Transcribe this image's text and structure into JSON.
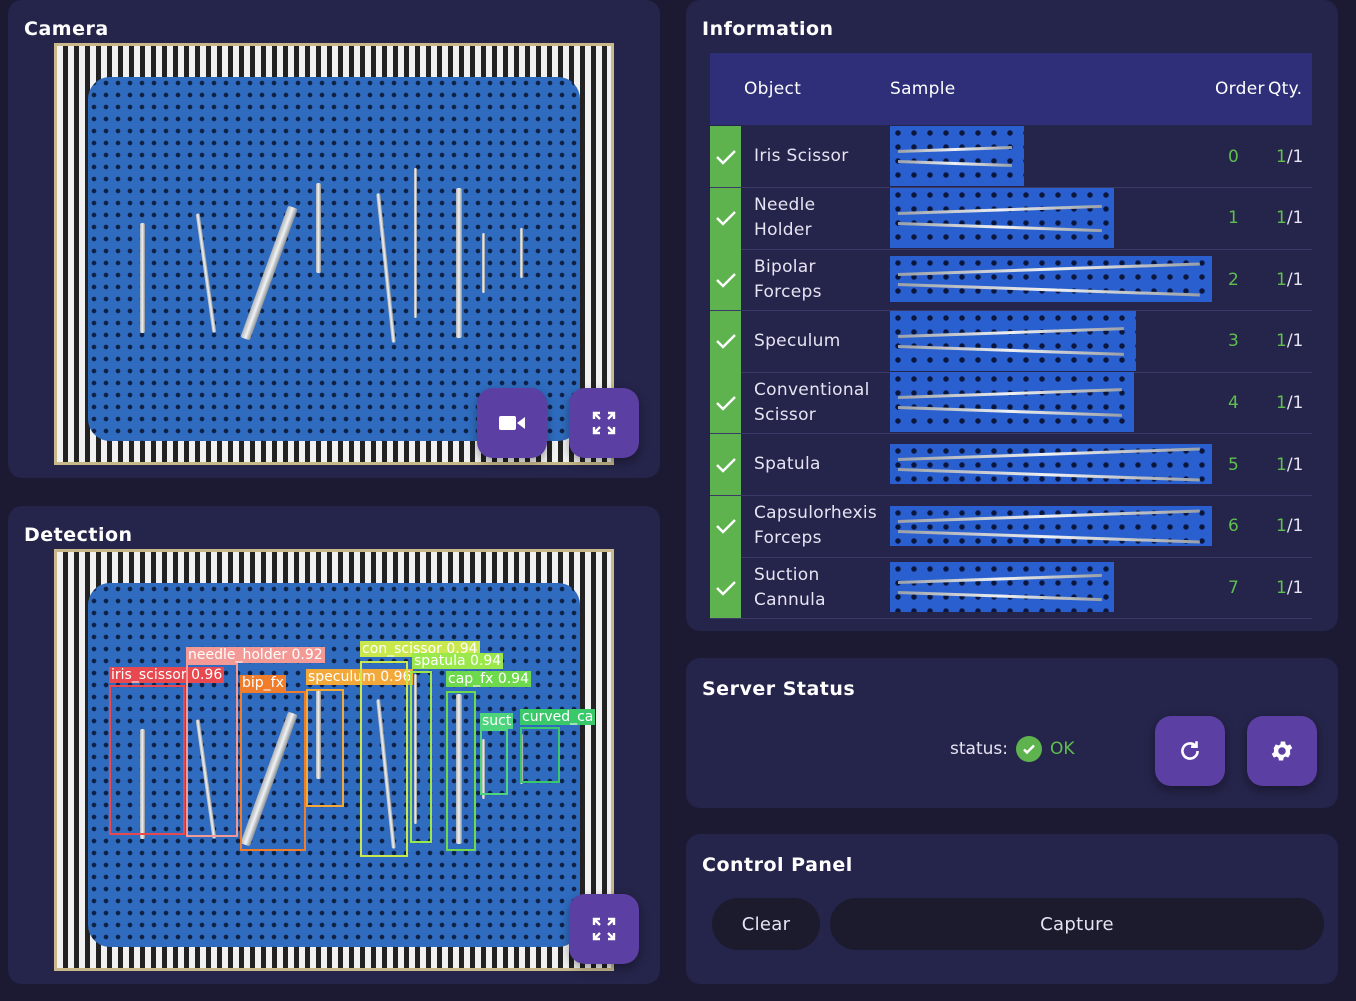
{
  "camera": {
    "title": "Camera"
  },
  "detection": {
    "title": "Detection",
    "boxes": [
      {
        "label": "iris_scissor 0.96",
        "color": "#e8484f"
      },
      {
        "label": "needle_holder 0.92",
        "color": "#f39a96"
      },
      {
        "label": "bip_fx",
        "color": "#f07d2c"
      },
      {
        "label": "speculum 0.96",
        "color": "#f3a93a"
      },
      {
        "label": "con_scissor 0.94",
        "color": "#c9e84e"
      },
      {
        "label": "spatula 0.94",
        "color": "#9be84c"
      },
      {
        "label": "cap_fx 0.94",
        "color": "#6fd94e"
      },
      {
        "label": "suct",
        "color": "#4ed47d"
      },
      {
        "label": "curved_ca",
        "color": "#39c96b"
      }
    ]
  },
  "information": {
    "title": "Information",
    "columns": {
      "object": "Object",
      "sample": "Sample",
      "order": "Order",
      "qty": "Qty."
    },
    "rows": [
      {
        "object": "Iris Scissor",
        "order": "0",
        "qty_num": "1",
        "qty_den": "/1"
      },
      {
        "object": "Needle\nHolder",
        "order": "1",
        "qty_num": "1",
        "qty_den": "/1"
      },
      {
        "object": "Bipolar\nForceps",
        "order": "2",
        "qty_num": "1",
        "qty_den": "/1"
      },
      {
        "object": "Speculum",
        "order": "3",
        "qty_num": "1",
        "qty_den": "/1"
      },
      {
        "object": "Conventional\nScissor",
        "order": "4",
        "qty_num": "1",
        "qty_den": "/1"
      },
      {
        "object": "Spatula",
        "order": "5",
        "qty_num": "1",
        "qty_den": "/1"
      },
      {
        "object": "Capsulorhexis\nForceps",
        "order": "6",
        "qty_num": "1",
        "qty_den": "/1"
      },
      {
        "object": "Suction\nCannula",
        "order": "7",
        "qty_num": "1",
        "qty_den": "/1"
      }
    ]
  },
  "server": {
    "title": "Server Status",
    "status_label": "status:",
    "status_value": "OK"
  },
  "control": {
    "title": "Control Panel",
    "clear_label": "Clear",
    "capture_label": "Capture"
  },
  "colors": {
    "accent": "#5b3fa3",
    "ok": "#5eb34f",
    "panel": "#25244a",
    "header": "#2e2f78"
  },
  "icons": {
    "camera": "video-camera-icon",
    "fullscreen": "fullscreen-icon",
    "refresh": "refresh-icon",
    "settings": "gear-icon",
    "check": "check-icon"
  }
}
